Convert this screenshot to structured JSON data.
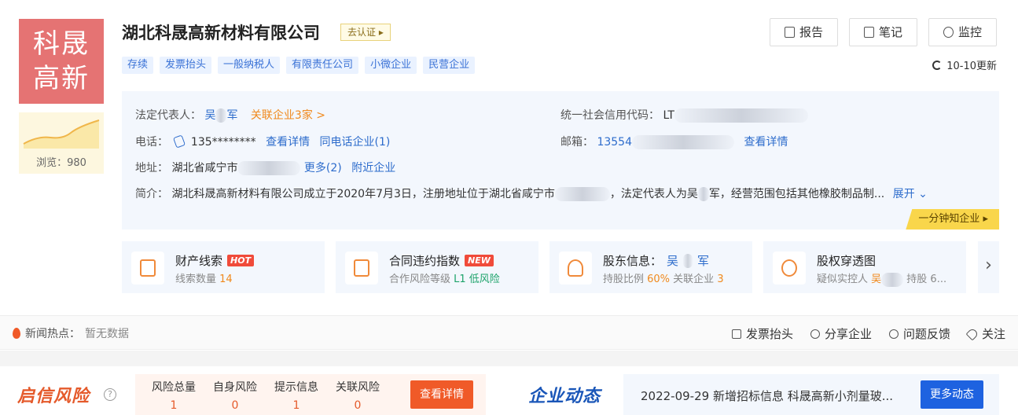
{
  "logo": {
    "line1": "科晟",
    "line2": "高新"
  },
  "views": "浏览：980",
  "company": {
    "name": "湖北科晟高新材料有限公司",
    "cert": "去认证 ▸"
  },
  "tags": [
    "存续",
    "发票抬头",
    "一般纳税人",
    "有限责任公司",
    "小微企业",
    "民营企业"
  ],
  "actions": {
    "report": "报告",
    "notes": "笔记",
    "monitor": "监控",
    "update": "10-10更新"
  },
  "info": {
    "legal_label": "法定代表人：",
    "legal_a": "吴",
    "legal_b": "军",
    "related": "关联企业3家 >",
    "credit_label": "统一社会信用代码：",
    "credit_value": "LT",
    "phone_label": "电话：",
    "phone_value": "135********",
    "phone_detail": "查看详情",
    "phone_same": "同电话企业(1)",
    "email_label": "邮箱：",
    "email_value": "13554",
    "email_detail": "查看详情",
    "address_label": "地址：",
    "address_value": "湖北省咸宁市",
    "address_more": "更多(2)",
    "address_nearby": "附近企业",
    "intro_label": "简介：",
    "intro_text_a": "湖北科晟高新材料有限公司成立于2020年7月3日，注册地址位于湖北省咸宁市",
    "intro_text_b": "，法定代表人为吴",
    "intro_text_c": "军，经营范围包括其他橡胶制品制...",
    "expand": "展开 ⌄",
    "quick": "一分钟知企业 ▸"
  },
  "cards": [
    {
      "title": "财产线索",
      "badge": "HOT",
      "sub_a": "线索数量 ",
      "sub_b": "14"
    },
    {
      "title": "合同违约指数",
      "badge": "NEW",
      "sub_a": "合作风险等级 ",
      "sub_b": "L1 低风险"
    },
    {
      "title": "股东信息：",
      "title_b": "吴",
      "title_c": "军",
      "sub_a": "持股比例 ",
      "sub_b": "60%",
      "sub_c": "  关联企业 ",
      "sub_d": "3"
    },
    {
      "title": "股权穿透图",
      "sub_a": "疑似实控人 ",
      "sub_b": "吴",
      "sub_c": " 持股 6..."
    }
  ],
  "next_arrow": "›",
  "news": {
    "label": "新闻热点：",
    "value": "暂无数据",
    "links": [
      "发票抬头",
      "分享企业",
      "问题反馈",
      "关注"
    ]
  },
  "risk": {
    "title": "启信风险",
    "help": "?",
    "cols": [
      {
        "label": "风险总量",
        "value": "1"
      },
      {
        "label": "自身风险",
        "value": "0"
      },
      {
        "label": "提示信息",
        "value": "1"
      },
      {
        "label": "关联风险",
        "value": "0"
      }
    ],
    "button": "查看详情"
  },
  "dynamics": {
    "title": "企业动态",
    "text": "2022-09-29 新增招标信息 科晟高新小剂量玻...",
    "button": "更多动态"
  },
  "colors": {
    "logo_bg": "#e57373",
    "tag_bg": "#eaf2ff",
    "accent_blue": "#2d6ccc",
    "risk_orange": "#f05a28",
    "dyn_blue": "#1e62e0"
  }
}
